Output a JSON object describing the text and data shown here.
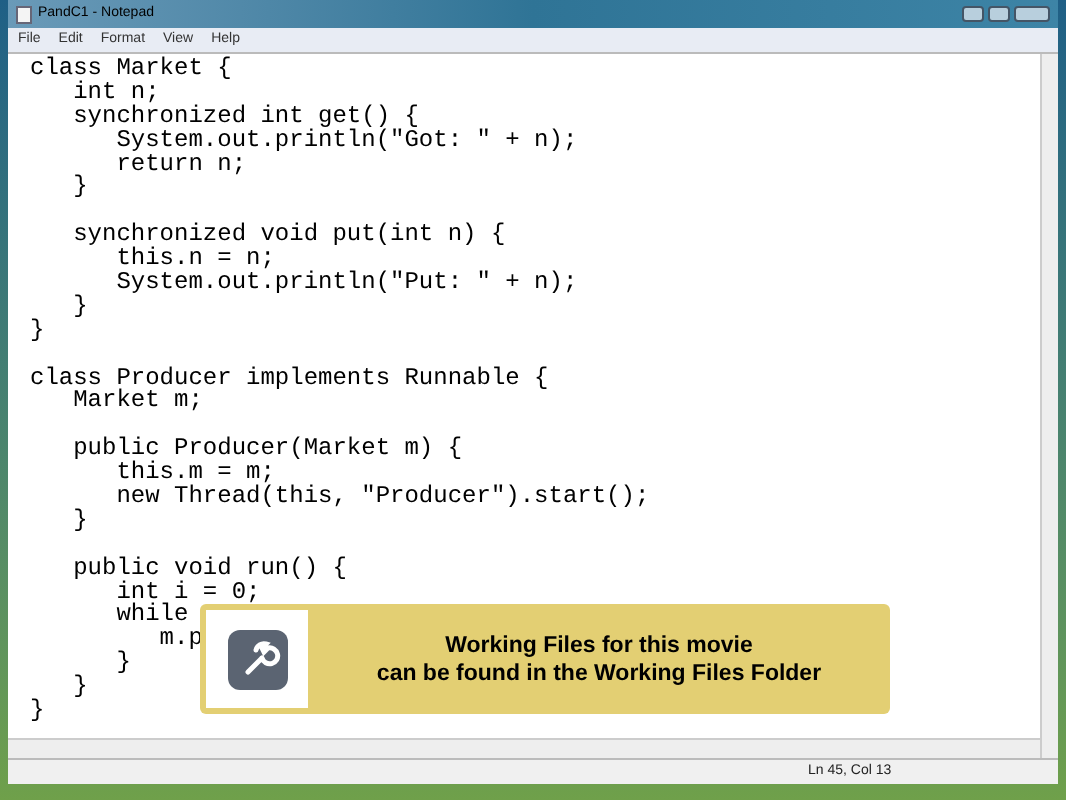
{
  "window": {
    "title": "PandC1 - Notepad"
  },
  "menu": [
    "File",
    "Edit",
    "Format",
    "View",
    "Help"
  ],
  "code_blocks": [
    [
      "class Market {",
      "   int n;",
      "   synchronized int get() {",
      "      System.out.println(\"Got: \" + n);",
      "      return n;",
      "   }"
    ],
    [
      "   synchronized void put(int n) {",
      "      this.n = n;",
      "      System.out.println(\"Put: \" + n);",
      "   }",
      "}"
    ],
    [
      "class Producer implements Runnable {",
      "   Market m;"
    ],
    [
      "   public Producer(Market m) {",
      "      this.m = m;",
      "      new Thread(this, \"Producer\").start();",
      "   }"
    ],
    [
      "   public void run() {",
      "      int i = 0;",
      "      while",
      "         m.p",
      "      }",
      "   }",
      "}"
    ]
  ],
  "status_bar": {
    "position": "Ln 45, Col 13"
  },
  "notice": {
    "lines": [
      "Working Files for this movie",
      "can be found in the Working Files Folder"
    ]
  }
}
